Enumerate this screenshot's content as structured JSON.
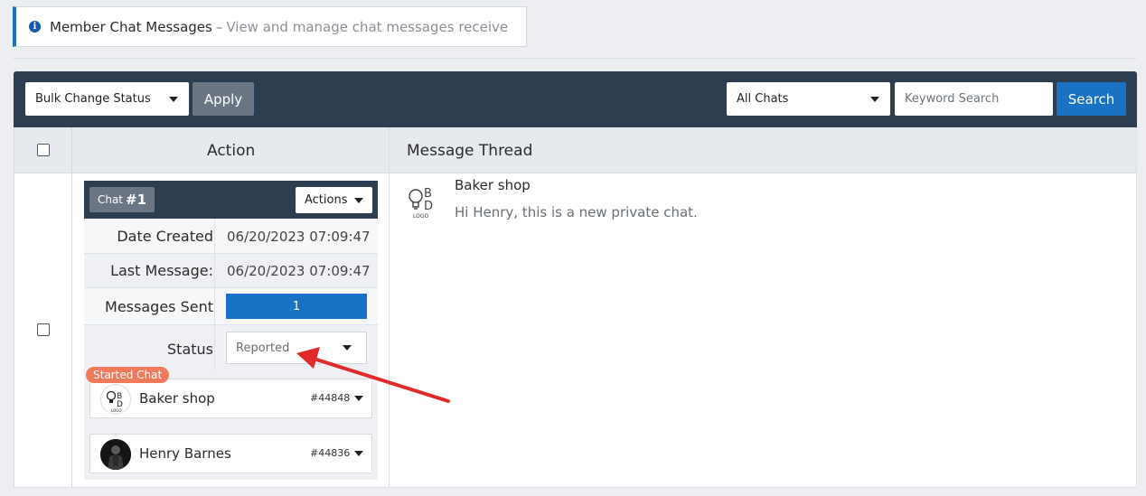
{
  "notice": {
    "title": "Member Chat Messages",
    "dash": "–",
    "description": "View and manage chat messages receive",
    "icon": "info-icon"
  },
  "toolbar": {
    "bulk_select": "Bulk Change Status",
    "apply_label": "Apply",
    "filter_select": "All Chats",
    "keyword_placeholder": "Keyword Search",
    "search_label": "Search"
  },
  "table": {
    "headers": [
      "Action",
      "Message Thread"
    ]
  },
  "chat": {
    "badge_prefix": "Chat",
    "badge_number": "#1",
    "actions_label": "Actions",
    "rows": [
      {
        "label": "Date Created",
        "value": "06/20/2023 07:09:47"
      },
      {
        "label": "Last Message:",
        "value": "06/20/2023 07:09:47"
      },
      {
        "label": "Messages Sent",
        "value": "1"
      },
      {
        "label": "Status",
        "value": "Reported"
      }
    ],
    "started_badge": "Started Chat",
    "members": [
      {
        "name": "Baker shop",
        "id": "#44848",
        "avatar": "logo-avatar"
      },
      {
        "name": "Henry Barnes",
        "id": "#44836",
        "avatar": "person-avatar"
      }
    ]
  },
  "thread": {
    "sender": "Baker shop",
    "message": "Hi Henry, this is a new private chat.",
    "logo_text": "LOGO"
  },
  "colors": {
    "toolbar_bg": "#2c3e50",
    "primary": "#1a72c4",
    "badge": "#f07a5a",
    "arrow": "#e32a2a"
  }
}
